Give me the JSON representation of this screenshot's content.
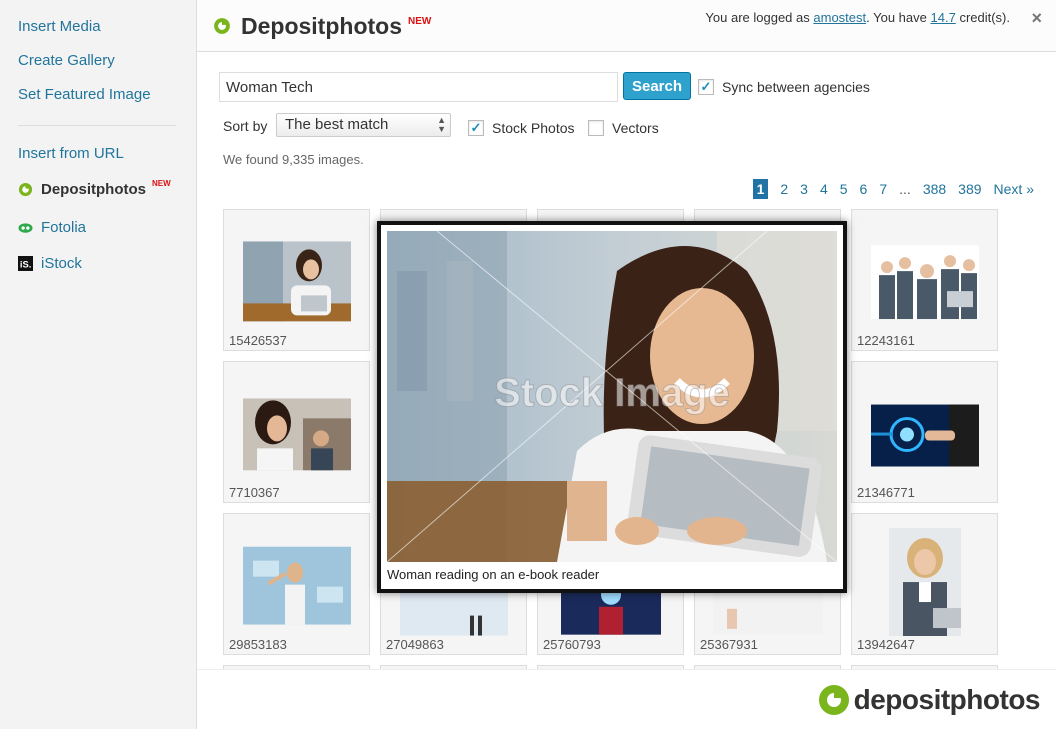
{
  "sidebar": {
    "items": [
      {
        "label": "Insert Media"
      },
      {
        "label": "Create Gallery"
      },
      {
        "label": "Set Featured Image"
      },
      {
        "label": "Insert from URL"
      },
      {
        "label": "Depositphotos",
        "badge": "NEW"
      },
      {
        "label": "Fotolia"
      },
      {
        "label": "iStock"
      }
    ]
  },
  "header": {
    "title": "Depositphotos",
    "badge": "NEW",
    "login_prefix": "You are logged as",
    "username": "amostest",
    "login_mid": ". You have",
    "credits": "14.7",
    "login_suffix": "credit(s).",
    "close": "×"
  },
  "search": {
    "value": "Woman Tech",
    "button": "Search",
    "sync_label": "Sync between agencies",
    "sync_checked": true
  },
  "sort": {
    "label": "Sort by",
    "selected": "The best match"
  },
  "filters": {
    "stock_photos": {
      "label": "Stock Photos",
      "checked": true
    },
    "vectors": {
      "label": "Vectors",
      "checked": false
    }
  },
  "results_text": "We found 9,335 images.",
  "pagination": {
    "current": "1",
    "pages": [
      "2",
      "3",
      "4",
      "5",
      "6",
      "7"
    ],
    "dots": "...",
    "tail": [
      "388",
      "389"
    ],
    "next": "Next »"
  },
  "tiles": [
    {
      "id": "15426537"
    },
    {
      "id": ""
    },
    {
      "id": ""
    },
    {
      "id": ""
    },
    {
      "id": "12243161"
    },
    {
      "id": "7710367"
    },
    {
      "id": ""
    },
    {
      "id": ""
    },
    {
      "id": ""
    },
    {
      "id": "21346771"
    },
    {
      "id": "29853183"
    },
    {
      "id": "27049863"
    },
    {
      "id": "25760793"
    },
    {
      "id": "25367931"
    },
    {
      "id": "13942647"
    }
  ],
  "preview": {
    "watermark": "Stock Image",
    "caption": "Woman reading on an e-book reader"
  },
  "footer": {
    "logo_text": "depositphotos"
  },
  "colors": {
    "link": "#21759b",
    "button": "#2ea2cc",
    "brand_green": "#7ab51d",
    "new_badge": "#dd1111"
  }
}
